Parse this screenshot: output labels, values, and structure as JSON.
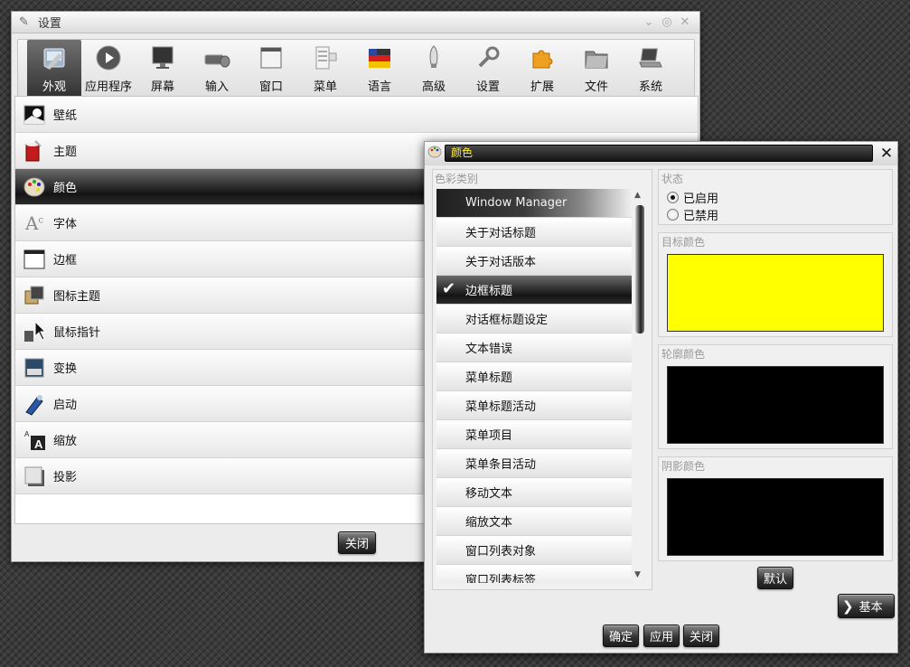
{
  "settings_window": {
    "title": "设置",
    "toolbar": [
      {
        "label": "外观",
        "icon": "appearance-icon",
        "active": true
      },
      {
        "label": "应用程序",
        "icon": "applications-icon"
      },
      {
        "label": "屏幕",
        "icon": "screen-icon"
      },
      {
        "label": "输入",
        "icon": "input-icon"
      },
      {
        "label": "窗口",
        "icon": "window-icon"
      },
      {
        "label": "菜单",
        "icon": "menu-icon"
      },
      {
        "label": "语言",
        "icon": "language-icon"
      },
      {
        "label": "高级",
        "icon": "advanced-icon"
      },
      {
        "label": "设置",
        "icon": "settings-icon"
      },
      {
        "label": "扩展",
        "icon": "extensions-icon"
      },
      {
        "label": "文件",
        "icon": "files-icon"
      },
      {
        "label": "系统",
        "icon": "system-icon"
      }
    ],
    "categories": [
      {
        "label": "壁纸",
        "icon": "wallpaper-icon"
      },
      {
        "label": "主题",
        "icon": "theme-icon"
      },
      {
        "label": "颜色",
        "icon": "color-palette-icon",
        "selected": true
      },
      {
        "label": "字体",
        "icon": "font-icon"
      },
      {
        "label": "边框",
        "icon": "border-icon"
      },
      {
        "label": "图标主题",
        "icon": "icon-theme-icon"
      },
      {
        "label": "鼠标指针",
        "icon": "mouse-pointer-icon"
      },
      {
        "label": "变换",
        "icon": "transition-icon"
      },
      {
        "label": "启动",
        "icon": "startup-icon"
      },
      {
        "label": "缩放",
        "icon": "scaling-icon"
      },
      {
        "label": "投影",
        "icon": "shadow-icon"
      }
    ],
    "close_button": "关闭"
  },
  "color_dialog": {
    "title": "颜色",
    "category_group_label": "色彩类别",
    "color_categories": [
      {
        "label": "Window Manager",
        "header": true
      },
      {
        "label": "关于对话标题"
      },
      {
        "label": "关于对话版本"
      },
      {
        "label": "边框标题",
        "checked": true
      },
      {
        "label": "对话框标题设定"
      },
      {
        "label": "文本错误"
      },
      {
        "label": "菜单标题"
      },
      {
        "label": "菜单标题活动"
      },
      {
        "label": "菜单项目"
      },
      {
        "label": "菜单条目活动"
      },
      {
        "label": "移动文本"
      },
      {
        "label": "缩放文本"
      },
      {
        "label": "窗口列表对象"
      },
      {
        "label": "窗口列表标签"
      }
    ],
    "state": {
      "label": "状态",
      "enabled_label": "已启用",
      "disabled_label": "已禁用",
      "selected": "enabled"
    },
    "target_color": {
      "label": "目标颜色",
      "color": "#ffff00"
    },
    "outline_color": {
      "label": "轮廓颜色",
      "color": "#000000"
    },
    "shadow_color": {
      "label": "阴影颜色",
      "color": "#000000"
    },
    "default_button": "默认",
    "basic_button": "基本",
    "ok_button": "确定",
    "apply_button": "应用",
    "close_button": "关闭"
  }
}
